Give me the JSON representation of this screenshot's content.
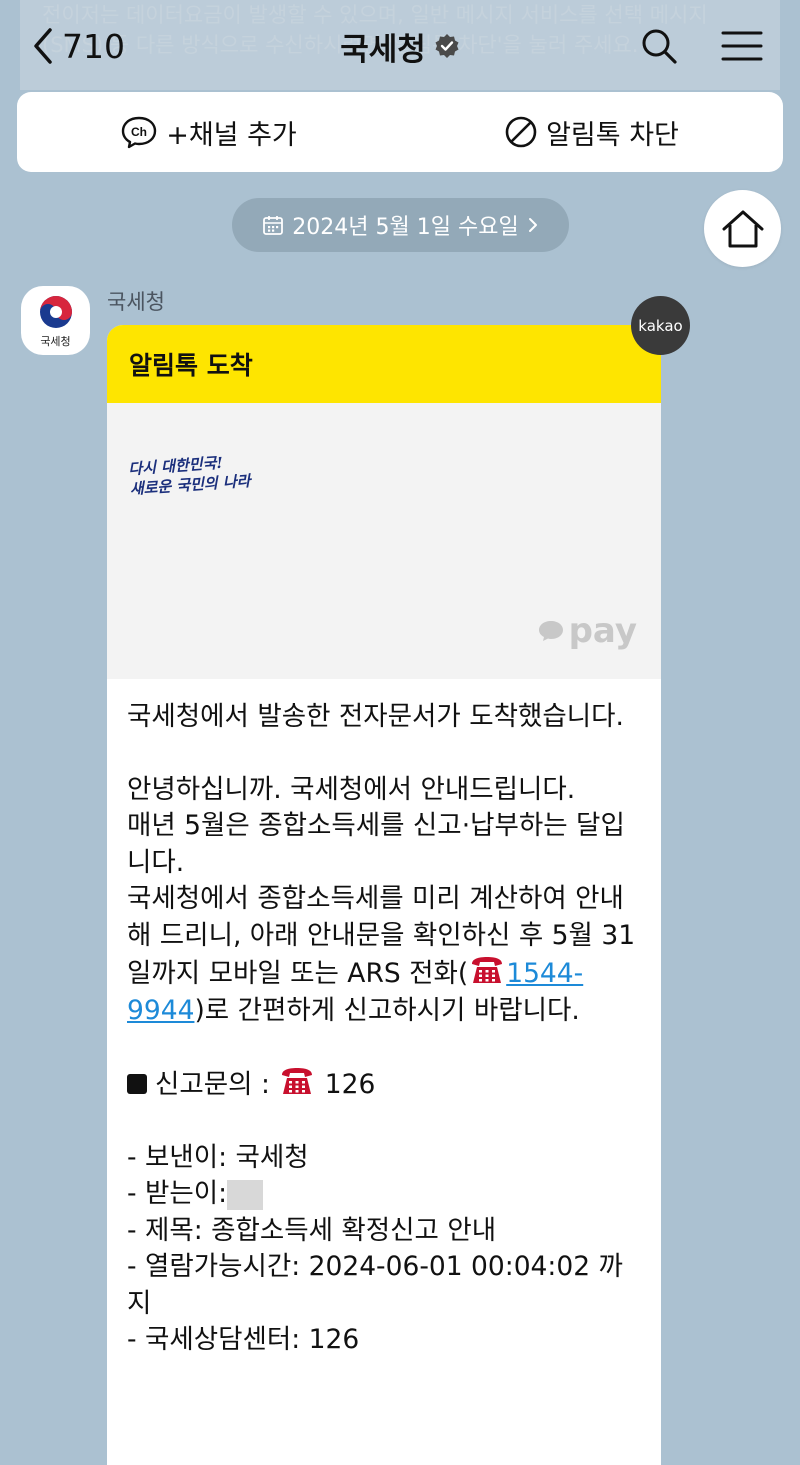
{
  "background_notice": "전이저는 데이터요금이 발생할 수 있으며, 일반 메시지 서비스를 선택 메시지(SMS) 등 다른 방식으로 수신하시려면 '알림톡 차단'을 눌러 주세요.",
  "header": {
    "back_count": "710",
    "title": "국세청",
    "verified_icon": "verified-badge-icon"
  },
  "actions": {
    "add_channel": "+채널 추가",
    "add_channel_icon_text": "Ch",
    "block": "알림톡 차단"
  },
  "date_pill": "2024년 5월 1일 수요일",
  "avatar_label": "국세청",
  "sender_name": "국세청",
  "kakao_badge": "kakao",
  "bubble": {
    "header": "알림톡 도착",
    "slogan_line1": "다시 대한민국!",
    "slogan_line2": "새로운 국민의 나라",
    "pay_label": "pay"
  },
  "message": {
    "line1": "국세청에서 발송한 전자문서가 도착했습니다.",
    "para2_a": "안녕하십니까. 국세청에서 안내드립니다.",
    "para2_b": "매년 5월은 종합소득세를 신고·납부하는 달입니다.",
    "para2_c": "국세청에서 종합소득세를 미리 계산하여 안내해 드리니, 아래 안내문을 확인하신 후 5월 31일까지 모바일 또는 ARS 전화(",
    "phone_link": "1544-9944",
    "para2_d": ")로 간편하게 신고하시기 바랍니다.",
    "inquiry_label": "신고문의 : ",
    "inquiry_number": "126",
    "sender_line": "- 보낸이: 국세청",
    "receiver_line": "- 받는이:",
    "subject_line": "- 제목: 종합소득세 확정신고 안내",
    "available_line": "- 열람가능시간: 2024-06-01 00:04:02 까지",
    "center_line": "- 국세상담센터: 126"
  },
  "colors": {
    "background": "#abc1d1",
    "kakao_yellow": "#fee500",
    "link": "#1d8ad8",
    "date_pill": "#93a9b8"
  }
}
